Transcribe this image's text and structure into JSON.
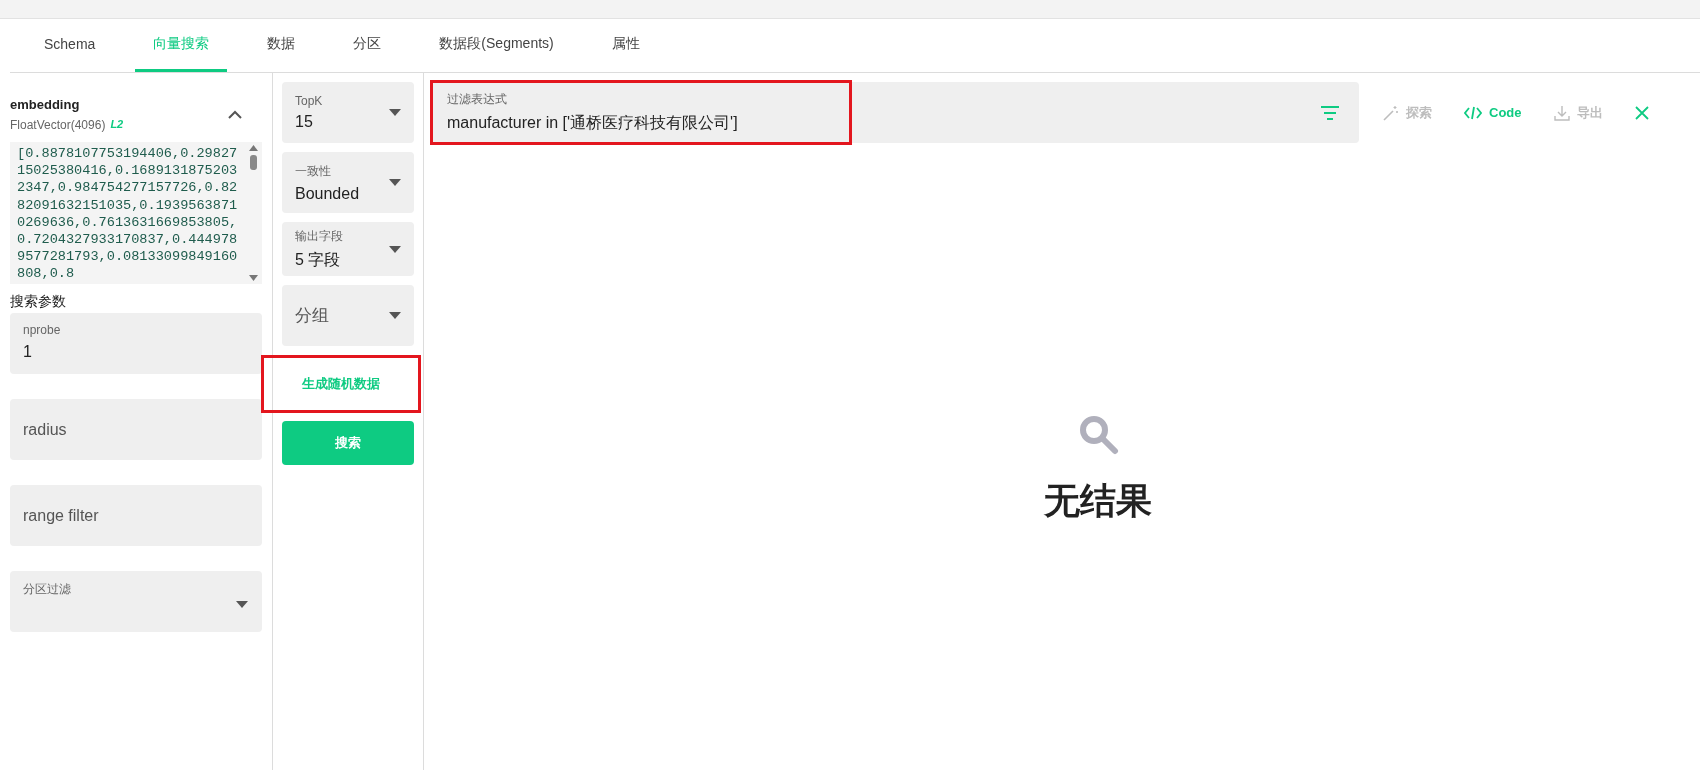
{
  "tabs": [
    {
      "label": "Schema",
      "selected": false
    },
    {
      "label": "向量搜索",
      "selected": true
    },
    {
      "label": "数据",
      "selected": false
    },
    {
      "label": "分区",
      "selected": false
    },
    {
      "label": "数据段(Segments)",
      "selected": false
    },
    {
      "label": "属性",
      "selected": false
    }
  ],
  "vector_field": {
    "name": "embedding",
    "type": "FloatVector(4096)",
    "metric": "L2",
    "expanded": true,
    "value": "[0.8878107753194406,0.2982715025380416,0.16891318752032347,0.984754277157726,0.8282091632151035,0.19395638710269636,0.7613631669853805,0.7204327933170837,0.4449789577281793,0.08133099849160808,0.8"
  },
  "search_params": {
    "title": "搜索参数",
    "fields": [
      {
        "kind": "input",
        "label": "nprobe",
        "value": "1"
      },
      {
        "kind": "input",
        "placeholder": "radius"
      },
      {
        "kind": "input",
        "placeholder": "range filter"
      },
      {
        "kind": "select",
        "label": "分区过滤"
      }
    ]
  },
  "options": [
    {
      "label": "TopK",
      "value": "15"
    },
    {
      "label": "一致性",
      "value": "Bounded"
    },
    {
      "label": "输出字段",
      "value": "5 字段"
    },
    {
      "placeholder": "分组"
    }
  ],
  "random_button": {
    "label": "生成随机数据",
    "highlighted": true
  },
  "search_button": {
    "label": "搜索"
  },
  "filter": {
    "label": "过滤表达式",
    "value": "manufacturer in ['通桥医疗科技有限公司']",
    "highlighted": true
  },
  "toolbar": [
    {
      "kind": "explore",
      "label": "探索",
      "disabled": true
    },
    {
      "kind": "code",
      "label": "Code",
      "disabled": false
    },
    {
      "kind": "export",
      "label": "导出",
      "disabled": true
    },
    {
      "kind": "close",
      "disabled": false
    }
  ],
  "empty_state": {
    "message": "无结果"
  }
}
